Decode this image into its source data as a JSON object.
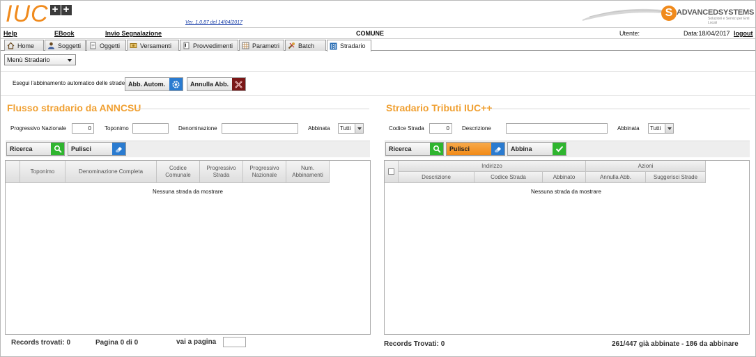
{
  "header": {
    "logo_text": "IUC",
    "version": "Ver. 1.0.87 del 14/04/2017",
    "brand_name": "ADVANCEDSYSTEMS",
    "brand_sub": "Soluzioni e Servizi per Enti Locali",
    "brand_mark": "S"
  },
  "menu": {
    "help": "Help",
    "ebook": "EBook",
    "invio": "Invio Segnalazione",
    "comune": "COMUNE",
    "utente": "Utente:",
    "data": "Data:18/04/2017",
    "logout": "logout"
  },
  "tabs": [
    {
      "label": "Home",
      "icon": "house-icon"
    },
    {
      "label": "Soggetti",
      "icon": "person-icon"
    },
    {
      "label": "Oggetti",
      "icon": "document-icon"
    },
    {
      "label": "Versamenti",
      "icon": "money-icon"
    },
    {
      "label": "Provvedimenti",
      "icon": "notice-icon"
    },
    {
      "label": "Parametri",
      "icon": "grid-icon"
    },
    {
      "label": "Batch",
      "icon": "tools-icon"
    },
    {
      "label": "Stradario",
      "icon": "street-icon",
      "active": true
    }
  ],
  "menu_select": "Menù Stradario",
  "auto": {
    "label": "Esegui l'abbinamento automatico delle strade:",
    "abb_autom": "Abb. Autom.",
    "annulla_abb": "Annulla Abb."
  },
  "left": {
    "title": "Flusso stradario da ANNCSU",
    "progressivo_label": "Progressivo Nazionale",
    "progressivo_value": "0",
    "toponimo_label": "Toponimo",
    "denominazione_label": "Denominazione",
    "abbinata_label": "Abbinata",
    "abbinata_value": "Tutti",
    "ricerca": "Ricerca",
    "pulisci": "Pulisci",
    "columns": [
      "Toponimo",
      "Denominazione Completa",
      "Codice Comunale",
      "Progressivo Strada",
      "Progressivo Nazionale",
      "Num. Abbinamenti"
    ],
    "empty": "Nessuna strada da mostrare",
    "records": "Records trovati: 0",
    "pagina": "Pagina 0 di 0",
    "vai": "vai a pagina"
  },
  "right": {
    "title": "Stradario Tributi IUC++",
    "codice_label": "Codice Strada",
    "codice_value": "0",
    "descrizione_label": "Descrizione",
    "abbinata_label": "Abbinata",
    "abbinata_value": "Tutti",
    "ricerca": "Ricerca",
    "pulisci": "Pulisci",
    "abbina": "Abbina",
    "group_indirizzo": "Indirizzo",
    "group_azioni": "Azioni",
    "columns": [
      "Descrizione",
      "Codice Strada",
      "Abbinato",
      "Annulla Abb.",
      "Suggerisci Strade"
    ],
    "empty": "Nessuna strada da mostrare",
    "records": "Records Trovati: 0",
    "summary": "261/447 già abbinate - 186 da abbinare"
  },
  "colors": {
    "accent": "#f08a1c",
    "title": "#f0a032",
    "green_button": "#2fb52f",
    "blue_button": "#2a7bd0",
    "red_button": "#7a1616"
  }
}
